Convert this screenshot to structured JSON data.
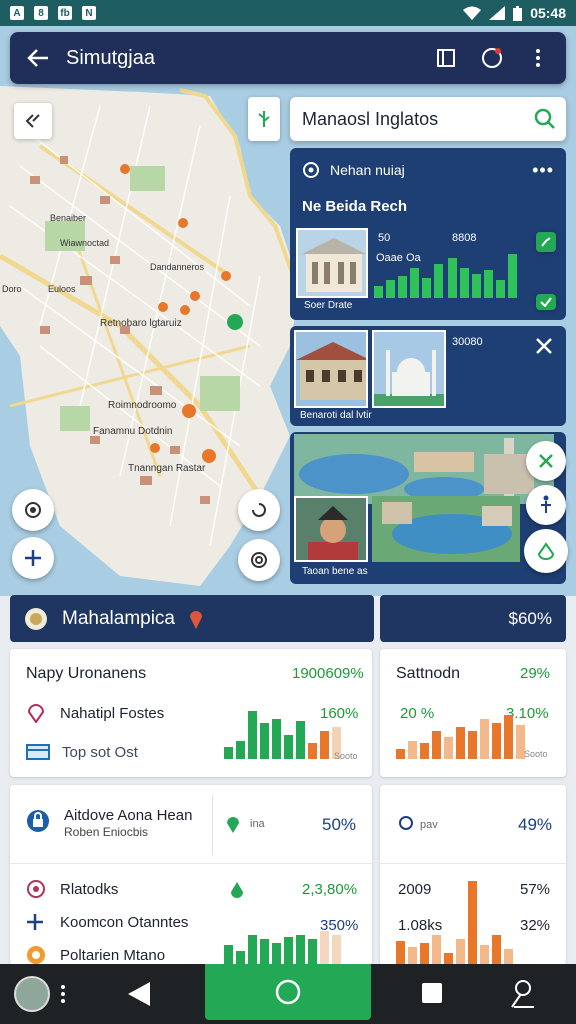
{
  "status": {
    "time": "05:48",
    "left_icons": [
      "A",
      "8",
      "fb",
      "N"
    ]
  },
  "appbar": {
    "title": "Simutgjaa"
  },
  "search": {
    "value": "Manaosl Inglatos",
    "placeholder": ""
  },
  "map_labels": [
    {
      "text": "Benaiber"
    },
    {
      "text": "Wiawnoctad"
    },
    {
      "text": "Dandanneros"
    },
    {
      "text": "Doro"
    },
    {
      "text": "Euloos"
    },
    {
      "text": "Retnobaro lgtaruiz"
    },
    {
      "text": "Roimnodroomo"
    },
    {
      "text": "Fanamnu Dotdnin"
    },
    {
      "text": "Tnanngan Rastar"
    }
  ],
  "panel": {
    "header": "Nehan nuiaj",
    "subtitle": "Ne Beida Rech",
    "stats": {
      "a": "50",
      "b": "8808",
      "c": "Oaae Oa"
    },
    "thumb_caption": "Soer Drate",
    "card2_value": "30080",
    "card2_caption": "Benaroti dal lvtir",
    "card3_caption": "Taoan bene as"
  },
  "location_bar": {
    "title": "Mahalampica",
    "value": "$60%"
  },
  "card_left_1": {
    "title": "Napy Uronanens",
    "title_value": "1900609%",
    "rows": [
      {
        "label": "Nahatipl Fostes",
        "value": "160%"
      },
      {
        "label": "Top sot Ost",
        "value": ""
      }
    ],
    "bar_tag": "Sooto",
    "bars_green": [
      12,
      18,
      48,
      36,
      40,
      24,
      38
    ],
    "bars_orange": [
      16,
      28,
      32
    ]
  },
  "card_right_1": {
    "title": "Sattnodn",
    "title_value": "29%",
    "left_value": "20 %",
    "right_value": "3.10%",
    "bar_tag": "Sooto",
    "bars": [
      10,
      18,
      16,
      28,
      22,
      32,
      28,
      40,
      36,
      44,
      34
    ]
  },
  "card_left_2": {
    "title": "Aitdove Aona Hean",
    "subtitle": "Roben Eniocbis",
    "mid_label": "ina",
    "value": "50%",
    "rows": [
      {
        "label": "Rlatodks",
        "value": "2,3,80%"
      },
      {
        "label": "Koomcon Otanntes",
        "value": "350%"
      },
      {
        "label": "Poltarien Mtano",
        "value": ""
      }
    ],
    "bars": [
      20,
      14,
      30,
      26,
      22,
      28,
      30,
      26,
      34,
      30
    ]
  },
  "card_right_2": {
    "label": "pav",
    "value": "49%",
    "row1_left": "2009",
    "row1_right": "57%",
    "row2_left": "1.08ks",
    "row2_right": "32%",
    "bars": [
      24,
      18,
      22,
      30,
      12,
      26,
      84,
      20,
      30,
      16
    ]
  },
  "colors": {
    "primary": "#1f2f59",
    "accent_green": "#23a955",
    "orange": "#e8772a",
    "map_water": "#a9cde3"
  }
}
